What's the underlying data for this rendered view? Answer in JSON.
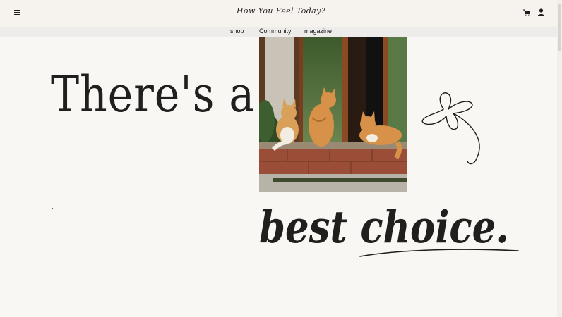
{
  "header": {
    "brand": "How You Feel Today?",
    "menu_icon": "hamburger-menu-icon",
    "cart_icon": "shopping-cart-icon",
    "user_icon": "user-account-icon"
  },
  "nav": {
    "links": [
      {
        "label": "shop"
      },
      {
        "label": "Community"
      },
      {
        "label": "magazine"
      }
    ]
  },
  "hero": {
    "line1": "There's a",
    "line2": "best choice.",
    "image_subject": "three orange tabby cats sitting on a window sill",
    "doodle_icon": "flower-doodle-icon"
  },
  "colors": {
    "background": "#f9f7f4",
    "header_bg": "#f6f3ef",
    "nav_bg": "#eeeceb",
    "text": "#1e1d1c"
  }
}
